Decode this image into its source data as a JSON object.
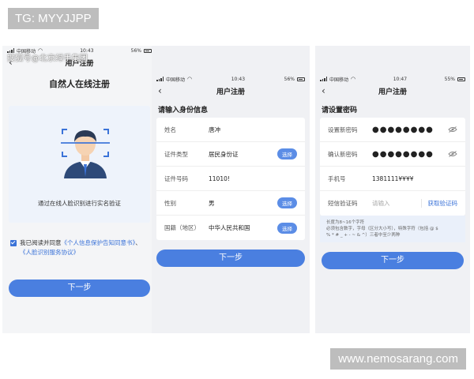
{
  "corner_tag": "TG: MYYJJPP",
  "watermark_site": "www.nemosarang.com",
  "overlay_watermark": "搜狐号@北京绿手集团",
  "icons": [
    "signal-icon",
    "wifi-icon",
    "battery-icon",
    "back-icon",
    "face-scan-avatar-icon",
    "checkbox-icon",
    "eye-off-icon"
  ],
  "colors": {
    "accent": "#4a7fe0",
    "link": "#3b73d8",
    "pill": "#5b8de6",
    "card_bg": "#eef3fb"
  },
  "screen1": {
    "status": {
      "carrier": "中国移动",
      "time": "10:43",
      "battery": "56%"
    },
    "nav_title": "用户注册",
    "page_title": "自然人在线注册",
    "scan_text": "通过在线人脸识别进行实名验证",
    "agree_prefix": "我已阅读并同意",
    "agree_link1": "《个人信息保护告知同意书》",
    "agree_sep": "、",
    "agree_link2": "《人脸识别服务协议》",
    "next_button": "下一步"
  },
  "screen2": {
    "status": {
      "carrier": "中国移动",
      "time": "10:43",
      "battery": "56%"
    },
    "nav_title": "用户注册",
    "section_title": "请输入身份信息",
    "fields": [
      {
        "label": "姓名",
        "value": "唐冲",
        "action": ""
      },
      {
        "label": "证件类型",
        "value": "居民身份证",
        "action": "选择"
      },
      {
        "label": "证件号码",
        "value": "11010!",
        "action": ""
      },
      {
        "label": "性别",
        "value": "男",
        "action": "选择"
      },
      {
        "label": "国籍（地区）",
        "value": "中华人民共和国",
        "action": "选择"
      }
    ],
    "next_button": "下一步"
  },
  "screen3": {
    "status": {
      "carrier": "中国移动",
      "time": "10:47",
      "battery": "55%"
    },
    "nav_title": "用户注册",
    "section_title": "请设置密码",
    "fields": {
      "new_password": {
        "label": "设置新密码",
        "value": "●●●●●●●●"
      },
      "confirm_password": {
        "label": "确认新密码",
        "value": "●●●●●●●●"
      },
      "phone": {
        "label": "手机号",
        "value": "1381111¥¥¥¥"
      },
      "sms_code": {
        "label": "短信验证码",
        "placeholder": "请输入",
        "action": "获取验证码"
      }
    },
    "hint_line1": "长度为8~16个字符",
    "hint_line2": "必须包含数字，字母（区分大小写），特殊字符（包括 @ $",
    "hint_line3": "% * # _ + - ~ & ^）三者中至少两种",
    "next_button": "下一步"
  }
}
